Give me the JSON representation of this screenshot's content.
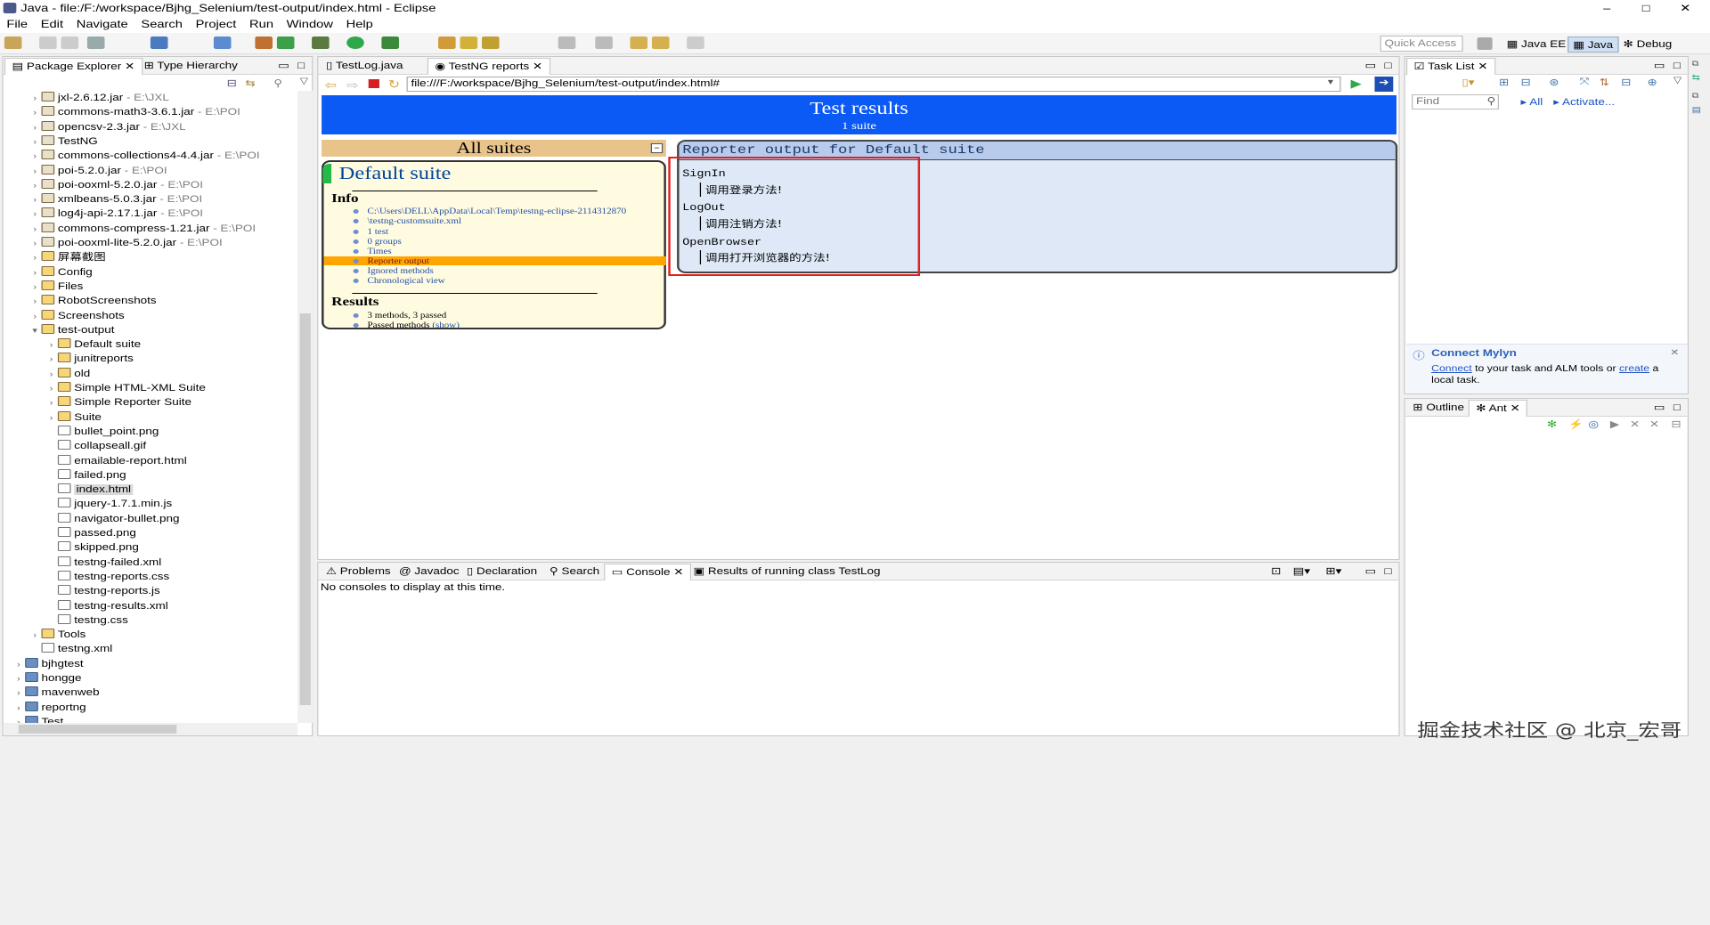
{
  "window": {
    "title": "Java - file:/F:/workspace/Bjhg_Selenium/test-output/index.html - Eclipse",
    "min": "–",
    "max": "□",
    "close": "✕"
  },
  "menu": [
    "File",
    "Edit",
    "Navigate",
    "Search",
    "Project",
    "Run",
    "Window",
    "Help"
  ],
  "quick_access": "Quick Access",
  "perspectives": [
    "Java EE",
    "Java",
    "Debug"
  ],
  "left_tabs": {
    "package_explorer": "Package Explorer",
    "type_hierarchy": "Type Hierarchy"
  },
  "tree": [
    {
      "label": "jxl-2.6.12.jar",
      "suffix": " - E:\\JXL",
      "kind": "jar",
      "d": 1
    },
    {
      "label": "commons-math3-3.6.1.jar",
      "suffix": " - E:\\POI",
      "kind": "jar",
      "d": 1
    },
    {
      "label": "opencsv-2.3.jar",
      "suffix": " - E:\\JXL",
      "kind": "jar",
      "d": 1
    },
    {
      "label": "TestNG",
      "suffix": "",
      "kind": "jar",
      "d": 1
    },
    {
      "label": "commons-collections4-4.4.jar",
      "suffix": " - E:\\POI",
      "kind": "jar",
      "d": 1
    },
    {
      "label": "poi-5.2.0.jar",
      "suffix": " - E:\\POI",
      "kind": "jar",
      "d": 1
    },
    {
      "label": "poi-ooxml-5.2.0.jar",
      "suffix": " - E:\\POI",
      "kind": "jar",
      "d": 1
    },
    {
      "label": "xmlbeans-5.0.3.jar",
      "suffix": " - E:\\POI",
      "kind": "jar",
      "d": 1
    },
    {
      "label": "log4j-api-2.17.1.jar",
      "suffix": " - E:\\POI",
      "kind": "jar",
      "d": 1
    },
    {
      "label": "commons-compress-1.21.jar",
      "suffix": " - E:\\POI",
      "kind": "jar",
      "d": 1
    },
    {
      "label": "poi-ooxml-lite-5.2.0.jar",
      "suffix": " - E:\\POI",
      "kind": "jar",
      "d": 1
    },
    {
      "label": "屏幕截图",
      "suffix": "",
      "kind": "folder",
      "d": 1
    },
    {
      "label": "Config",
      "suffix": "",
      "kind": "folder",
      "d": 1
    },
    {
      "label": "Files",
      "suffix": "",
      "kind": "folder",
      "d": 1
    },
    {
      "label": "RobotScreenshots",
      "suffix": "",
      "kind": "folder",
      "d": 1
    },
    {
      "label": "Screenshots",
      "suffix": "",
      "kind": "folder",
      "d": 1
    },
    {
      "label": "test-output",
      "suffix": "",
      "kind": "folder",
      "d": 1,
      "open": true
    },
    {
      "label": "Default suite",
      "suffix": "",
      "kind": "folder",
      "d": 2
    },
    {
      "label": "junitreports",
      "suffix": "",
      "kind": "folder",
      "d": 2
    },
    {
      "label": "old",
      "suffix": "",
      "kind": "folder",
      "d": 2
    },
    {
      "label": "Simple HTML-XML Suite",
      "suffix": "",
      "kind": "folder",
      "d": 2
    },
    {
      "label": "Simple Reporter Suite",
      "suffix": "",
      "kind": "folder",
      "d": 2
    },
    {
      "label": "Suite",
      "suffix": "",
      "kind": "folder",
      "d": 2
    },
    {
      "label": "bullet_point.png",
      "suffix": "",
      "kind": "file",
      "d": 2
    },
    {
      "label": "collapseall.gif",
      "suffix": "",
      "kind": "file",
      "d": 2
    },
    {
      "label": "emailable-report.html",
      "suffix": "",
      "kind": "file",
      "d": 2
    },
    {
      "label": "failed.png",
      "suffix": "",
      "kind": "file",
      "d": 2
    },
    {
      "label": "index.html",
      "suffix": "",
      "kind": "file",
      "d": 2,
      "sel": true
    },
    {
      "label": "jquery-1.7.1.min.js",
      "suffix": "",
      "kind": "file",
      "d": 2
    },
    {
      "label": "navigator-bullet.png",
      "suffix": "",
      "kind": "file",
      "d": 2
    },
    {
      "label": "passed.png",
      "suffix": "",
      "kind": "file",
      "d": 2
    },
    {
      "label": "skipped.png",
      "suffix": "",
      "kind": "file",
      "d": 2
    },
    {
      "label": "testng-failed.xml",
      "suffix": "",
      "kind": "file",
      "d": 2
    },
    {
      "label": "testng-reports.css",
      "suffix": "",
      "kind": "file",
      "d": 2
    },
    {
      "label": "testng-reports.js",
      "suffix": "",
      "kind": "file",
      "d": 2
    },
    {
      "label": "testng-results.xml",
      "suffix": "",
      "kind": "file",
      "d": 2
    },
    {
      "label": "testng.css",
      "suffix": "",
      "kind": "file",
      "d": 2
    },
    {
      "label": "Tools",
      "suffix": "",
      "kind": "folder",
      "d": 1
    },
    {
      "label": "testng.xml",
      "suffix": "",
      "kind": "file",
      "d": 1
    },
    {
      "label": "bjhgtest",
      "suffix": "",
      "kind": "proj",
      "d": 0
    },
    {
      "label": "hongge",
      "suffix": "",
      "kind": "proj",
      "d": 0
    },
    {
      "label": "mavenweb",
      "suffix": "",
      "kind": "proj",
      "d": 0
    },
    {
      "label": "reportng",
      "suffix": "",
      "kind": "proj",
      "d": 0
    },
    {
      "label": "Test",
      "suffix": "",
      "kind": "proj",
      "d": 0
    }
  ],
  "editor_tabs": [
    "TestLog.java",
    "TestNG reports"
  ],
  "url": "file:///F:/workspace/Bjhg_Selenium/test-output/index.html#",
  "report": {
    "title": "Test results",
    "subtitle": "1 suite",
    "all_suites": "All suites",
    "suite_name": "Default suite",
    "info_heading": "Info",
    "info_items": [
      "C:\\Users\\DELL\\AppData\\Local\\Temp\\testng-eclipse-2114312870",
      "\\testng-customsuite.xml",
      "1 test",
      "0 groups",
      "Times",
      "Reporter output",
      "Ignored methods",
      "Chronological view"
    ],
    "results_heading": "Results",
    "results_items": [
      "3 methods, 3 passed",
      "Passed methods"
    ],
    "show": "(show)",
    "reporter_header": "Reporter output for Default suite",
    "methods": [
      {
        "name": "SignIn",
        "msg": "调用登录方法!"
      },
      {
        "name": "LogOut",
        "msg": "调用注销方法!"
      },
      {
        "name": "OpenBrowser",
        "msg": "调用打开浏览器的方法!"
      }
    ]
  },
  "bottom_tabs": [
    "Problems",
    "Javadoc",
    "Declaration",
    "Search",
    "Console",
    "Results of running class TestLog"
  ],
  "console_text": "No consoles to display at this time.",
  "task_list": {
    "tab": "Task List",
    "find": "Find",
    "all": "All",
    "activate": "Activate..."
  },
  "mylyn": {
    "title": "Connect Mylyn",
    "connect": "Connect",
    "mid": " to your task and ALM tools or ",
    "create": "create",
    "end": " a local task."
  },
  "outline_tabs": [
    "Outline",
    "Ant"
  ],
  "watermark": "掘金技术社区 @ 北京_宏哥"
}
